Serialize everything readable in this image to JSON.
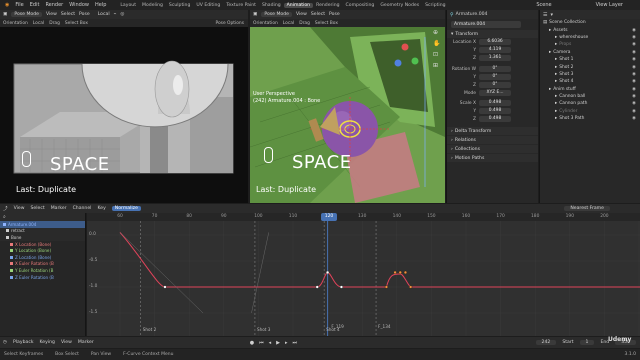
{
  "menu": [
    "File",
    "Edit",
    "Render",
    "Window",
    "Help"
  ],
  "workspaces": [
    "Layout",
    "Modeling",
    "Sculpting",
    "UV Editing",
    "Texture Paint",
    "Shading",
    "Animation",
    "Rendering",
    "Compositing",
    "Geometry Nodes",
    "Scripting"
  ],
  "active_workspace": "Animation",
  "scene_label": "Scene",
  "view_layer_label": "View Layer",
  "left_viewport": {
    "mode": "Pose Mode",
    "menus": [
      "View",
      "Select",
      "Pose"
    ],
    "orientation_label": "Orientation",
    "orientation_value": "Local",
    "drag_label": "Drag",
    "drag_value": "Select Box",
    "pose_options": "Pose Options",
    "space_text": "SPACE",
    "last_text": "Last: Duplicate"
  },
  "right_viewport": {
    "mode": "Pose Mode",
    "menus": [
      "View",
      "Select",
      "Pose"
    ],
    "orientation_label": "Orientation",
    "orientation_value": "Local",
    "drag_label": "Drag",
    "drag_value": "Select Box",
    "perspective": "User Perspective",
    "object_info": "(242) Armature.004 : Bone",
    "space_text": "SPACE",
    "last_text": "Last: Duplicate"
  },
  "properties": {
    "object_name": "Armature.004",
    "field_name": "Armature.004",
    "transform_label": "Transform",
    "location_label": "Location X",
    "location": [
      "6.6036",
      "4.119",
      "1.361"
    ],
    "rotation_label": "Rotation W",
    "rotation": [
      "0°",
      "0°",
      "0°"
    ],
    "mode_label": "Mode",
    "mode_value": "XYZ E...",
    "scale_label": "Scale X",
    "scale": [
      "0.498",
      "0.498",
      "0.498"
    ],
    "axis_labels": [
      "Y",
      "Z"
    ],
    "sections": [
      "Delta Transform",
      "Relations",
      "Collections",
      "Motion Paths"
    ]
  },
  "outliner": {
    "root": "Scene Collection",
    "items": [
      {
        "name": "Assets",
        "indent": 1,
        "color": "#d0d0d0"
      },
      {
        "name": "whereshouse",
        "indent": 2,
        "color": "#d0d0d0"
      },
      {
        "name": "Props",
        "indent": 2,
        "color": "#7a7a7a"
      },
      {
        "name": "Camera",
        "indent": 1,
        "color": "#d0d0d0"
      },
      {
        "name": "Shot 1",
        "indent": 2,
        "color": "#d0d0d0"
      },
      {
        "name": "Shot 2",
        "indent": 2,
        "color": "#d0d0d0"
      },
      {
        "name": "Shot 3",
        "indent": 2,
        "color": "#d0d0d0"
      },
      {
        "name": "Shot 4",
        "indent": 2,
        "color": "#d0d0d0"
      },
      {
        "name": "Anim stuff",
        "indent": 1,
        "color": "#d0d0d0"
      },
      {
        "name": "Cannon ball",
        "indent": 2,
        "color": "#d0d0d0"
      },
      {
        "name": "Cannon path",
        "indent": 2,
        "color": "#d0d0d0"
      },
      {
        "name": "Cylinder",
        "indent": 2,
        "color": "#7a7a7a"
      },
      {
        "name": "Shot 3 Path",
        "indent": 2,
        "color": "#d0d0d0"
      }
    ]
  },
  "graph_editor": {
    "menus": [
      "View",
      "Select",
      "Marker",
      "Channel",
      "Key"
    ],
    "normalize": "Normalize",
    "pivot": "Nearest Frame",
    "channels": [
      {
        "name": "Armature.004",
        "color": "#8fb4ff",
        "bg": "#3d5c8a"
      },
      {
        "name": "retract",
        "color": "#cfcfcf",
        "bg": "#2a2a2a"
      },
      {
        "name": "Bone",
        "color": "#cfcfcf",
        "bg": "#2a2a2a"
      },
      {
        "name": "X Location (Bone)",
        "color": "#e87a7a",
        "bg": "#262626"
      },
      {
        "name": "Y Location (Bone)",
        "color": "#9ad37a",
        "bg": "#262626"
      },
      {
        "name": "Z Location (Bone)",
        "color": "#7aa4e8",
        "bg": "#262626"
      },
      {
        "name": "X Euler Rotation (B",
        "color": "#e87a7a",
        "bg": "#262626"
      },
      {
        "name": "Y Euler Rotation (B",
        "color": "#9ad37a",
        "bg": "#262626"
      },
      {
        "name": "Z Euler Rotation (B",
        "color": "#7aa4e8",
        "bg": "#262626"
      }
    ],
    "ticks": [
      "60",
      "70",
      "80",
      "90",
      "100",
      "110",
      "120",
      "130",
      "140",
      "150",
      "160",
      "170",
      "180",
      "190",
      "200"
    ],
    "y_labels": [
      "0.0",
      "-0.5",
      "-1.0",
      "-1.5"
    ],
    "current_frame": "120",
    "markers": [
      "Shot 2",
      "Shot 3",
      "Shot 4",
      "F_119",
      "F_134"
    ]
  },
  "playback": {
    "menus": [
      "Playback",
      "Keying",
      "View",
      "Marker"
    ],
    "frame": "242",
    "start_label": "Start",
    "start": "1",
    "end_label": "End",
    "end": "350"
  },
  "status": {
    "items": [
      "Select Keyframes",
      "Box Select",
      "Pan View",
      "F-Curve Context Menu"
    ],
    "version": "3.1.0"
  },
  "watermark": "Udemy"
}
